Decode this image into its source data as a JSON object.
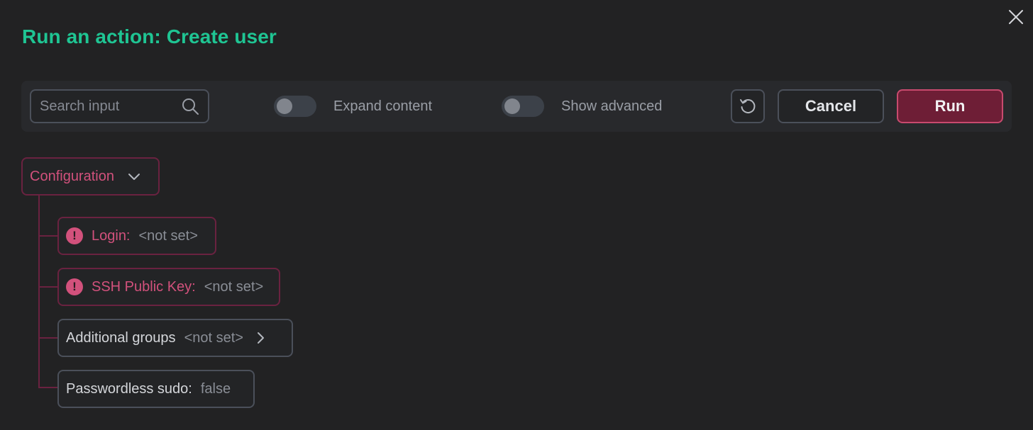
{
  "dialog": {
    "title": "Run an action: Create user"
  },
  "toolbar": {
    "search": {
      "value": "",
      "placeholder": "Search input"
    },
    "expand_content": {
      "label": "Expand content",
      "checked": false
    },
    "show_advanced": {
      "label": "Show advanced",
      "checked": false
    },
    "cancel_label": "Cancel",
    "run_label": "Run"
  },
  "tree": {
    "group": {
      "label": "Configuration",
      "expanded": true
    },
    "items": [
      {
        "label": "Login:",
        "value": "<not set>",
        "error": true
      },
      {
        "label": "SSH Public Key:",
        "value": "<not set>",
        "error": true
      },
      {
        "label": "Additional groups",
        "value": "<not set>",
        "error": false,
        "has_children": true
      },
      {
        "label": "Passwordless sudo:",
        "value": "false",
        "error": false
      }
    ]
  },
  "colors": {
    "title": "#1fc593",
    "error": "#d2517c",
    "run_fill": "#6e1e36",
    "run_border": "#c84a6e"
  },
  "icons": {
    "close": "close-icon",
    "search": "search-icon",
    "refresh": "refresh-icon",
    "expand": "chevron-down-icon",
    "error": "error-icon",
    "children": "chevron-right-icon"
  }
}
